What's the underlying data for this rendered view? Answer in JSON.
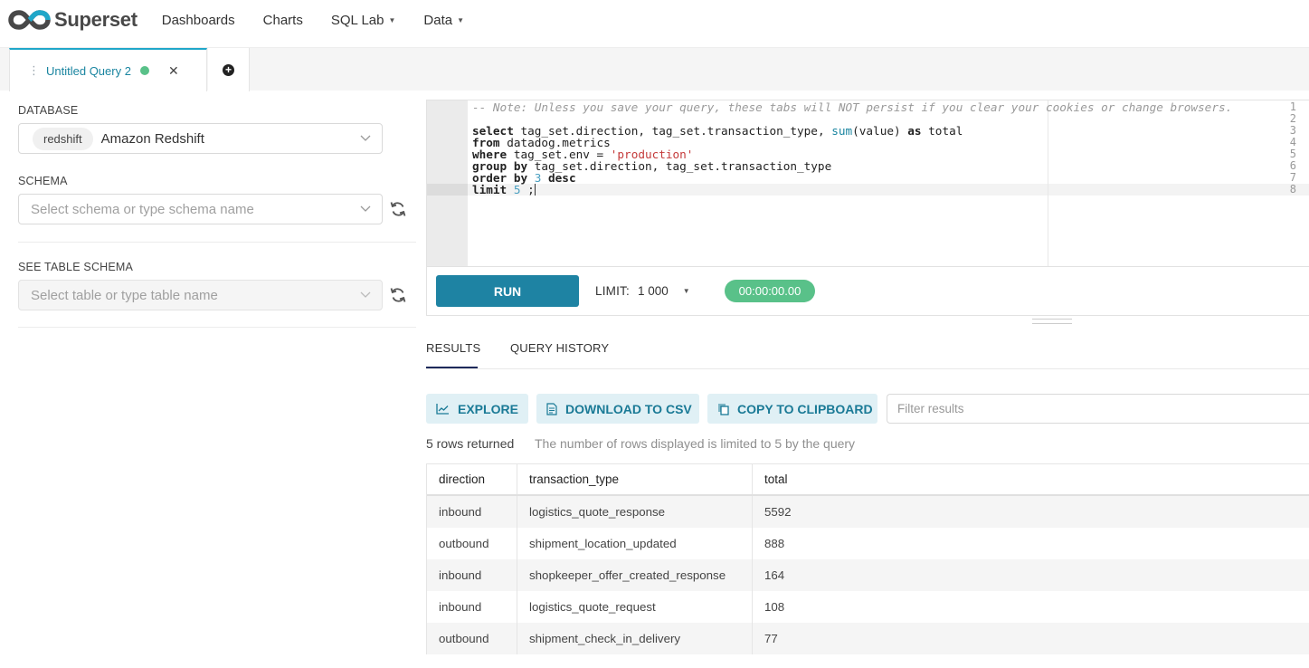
{
  "navbar": {
    "brand": "Superset",
    "items": [
      {
        "label": "Dashboards",
        "has_caret": false
      },
      {
        "label": "Charts",
        "has_caret": false
      },
      {
        "label": "SQL Lab",
        "has_caret": true
      },
      {
        "label": "Data",
        "has_caret": true
      }
    ]
  },
  "tabs": {
    "active_label": "Untitled Query 2",
    "status_color": "#59c189"
  },
  "left": {
    "database_label": "DATABASE",
    "database_chip": "redshift",
    "database_name": "Amazon Redshift",
    "schema_label": "SCHEMA",
    "schema_placeholder": "Select schema or type schema name",
    "table_label": "SEE TABLE SCHEMA",
    "table_placeholder": "Select table or type table name"
  },
  "editor": {
    "line_numbers": [
      "1",
      "2",
      "3",
      "4",
      "5",
      "6",
      "7",
      "8"
    ],
    "active_line": 8,
    "comment": "-- Note: Unless you save your query, these tabs will NOT persist if you clear your cookies or change browsers.",
    "line3": {
      "kw1": "select",
      "t1": " tag_set.direction, tag_set.transaction_type, ",
      "fn": "sum",
      "t2": "(value) ",
      "kw2": "as",
      "t3": " total"
    },
    "line4": {
      "kw": "from",
      "t": " datadog.metrics"
    },
    "line5": {
      "kw": "where",
      "t": " tag_set.env = ",
      "str": "'production'"
    },
    "line6": {
      "kw": "group by",
      "t": " tag_set.direction, tag_set.transaction_type"
    },
    "line7": {
      "kw1": "order by",
      "num": "3",
      "kw2": "desc"
    },
    "line8": {
      "kw": "limit",
      "num": "5",
      "t": " ;"
    }
  },
  "runbar": {
    "run_label": "RUN",
    "limit_label": "LIMIT:",
    "limit_value": "1 000",
    "timer": "00:00:00.00"
  },
  "results": {
    "tabs": [
      "RESULTS",
      "QUERY HISTORY"
    ],
    "buttons": {
      "explore": "EXPLORE",
      "download": "DOWNLOAD TO CSV",
      "copy": "COPY TO CLIPBOARD"
    },
    "filter_placeholder": "Filter results",
    "rows_returned": "5 rows returned",
    "rows_note": "The number of rows displayed is limited to 5 by the query",
    "columns": [
      "direction",
      "transaction_type",
      "total"
    ],
    "rows": [
      [
        "inbound",
        "logistics_quote_response",
        "5592"
      ],
      [
        "outbound",
        "shipment_location_updated",
        "888"
      ],
      [
        "inbound",
        "shopkeeper_offer_created_response",
        "164"
      ],
      [
        "inbound",
        "logistics_quote_request",
        "108"
      ],
      [
        "outbound",
        "shipment_check_in_delivery",
        "77"
      ]
    ]
  },
  "colors": {
    "accent": "#20a7c9",
    "run_button": "#1e83a3",
    "success": "#59c189"
  }
}
